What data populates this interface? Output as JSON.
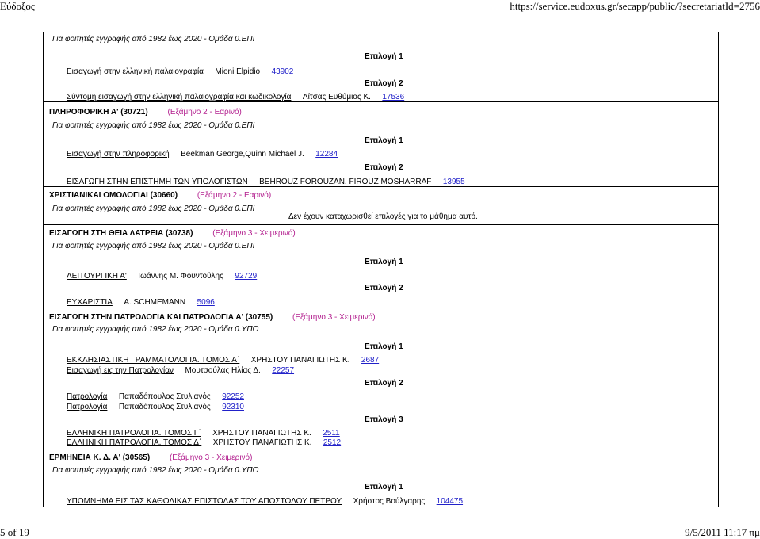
{
  "header": {
    "title": "Εύδοξος",
    "url": "https://service.eudoxus.gr/secapp/public/?secretariatId=2756"
  },
  "footer": {
    "page": "5 of 19",
    "datetime": "9/5/2011 11:17 πμ"
  },
  "note_epi": "Για φοιτητές εγγραφής από 1982 έως 2020 - Ομάδα 0.ΕΠΙ",
  "note_ypo": "Για φοιτητές εγγραφής από 1982 έως 2020 - Ομάδα 0.ΥΠΟ",
  "top_books": [
    {
      "title": "Εισαγωγή στην ελληνική παλαιογραφία",
      "author": "Mioni Elpidio",
      "code": "43902"
    },
    {
      "title": "Σύντομη εισαγωγή στην ελληνική παλαιογραφία και κωδικολογία",
      "author": "Λίτσας Ευθύμιος Κ.",
      "code": "17536"
    }
  ],
  "choices": {
    "c1": "Επιλογή 1",
    "c2": "Επιλογή 2",
    "c3": "Επιλογή 3"
  },
  "courses": {
    "pliroforiki": {
      "name": "ΠΛΗΡΟΦΟΡΙΚΗ Α' (30721)",
      "semester": "(Εξάμηνο 2 - Εαρινό)",
      "books": [
        {
          "title": "Εισαγωγή στην πληροφορική",
          "author": "Beekman George,Quinn Michael J.",
          "code": "12284"
        },
        {
          "title": "ΕΙΣΑΓΩΓΗ ΣΤΗΝ ΕΠΙΣΤΗΜΗ ΤΩΝ ΥΠΟΛΟΓΙΣΤΩΝ",
          "author": "BEHROUZ FOROUZAN, FIROUZ MOSHARRAF",
          "code": "13955"
        }
      ]
    },
    "christianikai": {
      "name": "ΧΡΙΣΤΙΑΝΙΚΑΙ ΟΜΟΛΟΓΙΑΙ (30660)",
      "semester": "(Εξάμηνο 2 - Εαρινό)",
      "no_choices": "Δεν έχουν καταχωρισθεί επιλογές για το μάθημα αυτό."
    },
    "latreia": {
      "name": "ΕΙΣΑΓΩΓΗ ΣΤΗ ΘΕΙΑ ΛΑΤΡΕΙΑ (30738)",
      "semester": "(Εξάμηνο 3 - Χειμερινό)",
      "books": [
        {
          "title": "ΛΕΙΤΟΥΡΓΙΚΗ Α'",
          "author": "Ιωάννης Μ. Φουντούλης",
          "code": "92729"
        },
        {
          "title": "ΕΥΧΑΡΙΣΤΙΑ",
          "author": "A. SCHMEMANN",
          "code": "5096"
        }
      ]
    },
    "patrologia": {
      "name": "ΕΙΣΑΓΩΓΗ ΣΤΗΝ ΠΑΤΡΟΛΟΓΙΑ ΚΑΙ ΠΑΤΡΟΛΟΓΙΑ Α' (30755)",
      "semester": "(Εξάμηνο 3 - Χειμερινό)",
      "books": [
        {
          "title": "ΕΚΚΛΗΣΙΑΣΤΙΚΗ ΓΡΑΜΜΑΤΟΛΟΓΙΑ. ΤΟΜΟΣ Α΄",
          "author": "ΧΡΗΣΤΟΥ ΠΑΝΑΓΙΩΤΗΣ Κ.",
          "code": "2687"
        },
        {
          "title": "Εισαγωγή εις την Πατρολογίαν",
          "author": "Μουτσούλας Ηλίας Δ.",
          "code": "22257"
        },
        {
          "title": "Πατρολογία",
          "author": "Παπαδόπουλος Στυλιανός",
          "code": "92252"
        },
        {
          "title": "Πατρολογία",
          "author": "Παπαδόπουλος Στυλιανός",
          "code": "92310"
        },
        {
          "title": "ΕΛΛΗΝΙΚΗ ΠΑΤΡΟΛΟΓΙΑ. ΤΟΜΟΣ Γ΄",
          "author": "ΧΡΗΣΤΟΥ ΠΑΝΑΓΙΩΤΗΣ Κ.",
          "code": "2511"
        },
        {
          "title": "ΕΛΛΗΝΙΚΗ ΠΑΤΡΟΛΟΓΙΑ. ΤΟΜΟΣ Δ΄",
          "author": "ΧΡΗΣΤΟΥ ΠΑΝΑΓΙΩΤΗΣ Κ.",
          "code": "2512"
        }
      ]
    },
    "ermineia": {
      "name": "ΕΡΜΗΝΕΙΑ Κ. Δ. Α' (30565)",
      "semester": "(Εξάμηνο 3 - Χειμερινό)",
      "books": [
        {
          "title": "ΥΠΟΜΝΗΜΑ ΕΙΣ ΤΑΣ ΚΑΘΟΛΙΚΑΣ ΕΠΙΣΤΟΛΑΣ ΤΟΥ ΑΠΟΣΤΟΛΟΥ ΠΕΤΡΟΥ",
          "author": "Χρήστος Βούλγαρης",
          "code": "104475"
        }
      ]
    }
  }
}
